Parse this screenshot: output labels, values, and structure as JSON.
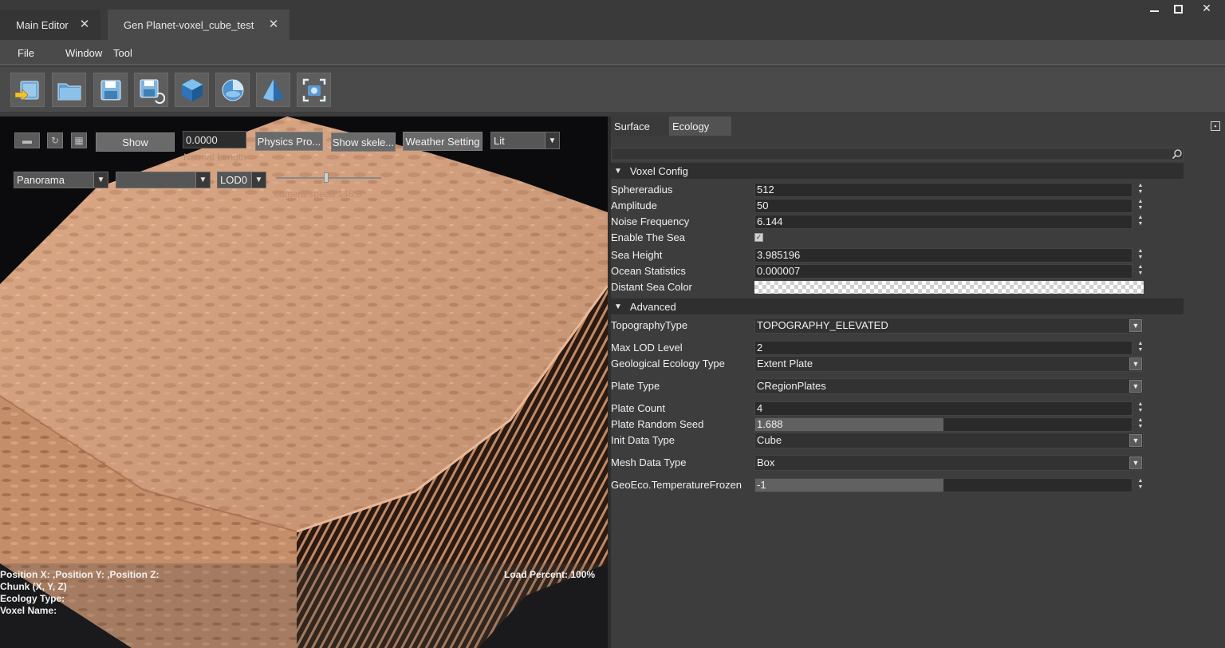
{
  "tabs": {
    "main_editor": "Main Editor",
    "gen_planet": "Gen Planet-voxel_cube_test"
  },
  "menu": {
    "file": "File",
    "window": "Window",
    "tool": "Tool"
  },
  "toolbar": {
    "icons": [
      "import-icon",
      "open-folder-icon",
      "save-icon",
      "save-as-icon",
      "cube-icon",
      "sphere-icon",
      "pyramid-icon",
      "capture-icon"
    ]
  },
  "viewport": {
    "show_label": "Show",
    "normal_length_value": "0.0000",
    "normal_length_caption": "Normal Length",
    "physics_label": "Physics Pro...",
    "skeleton_label": "Show skele...",
    "weather_label": "Weather Setting",
    "lit_value": "Lit",
    "panorama_value": "Panorama",
    "empty_select_value": "",
    "lod_value": "LOD0",
    "camera_speed_caption": "camera speed 148.3",
    "camera_speed_level": 0.48,
    "hud": {
      "position": "Position X: ,Position Y: ,Position Z:",
      "chunk": "Chunk (X, Y, Z)",
      "ecology_type": "Ecology Type:",
      "voxel_name": "Voxel Name:",
      "load_percent": "Load Percent: 100%"
    }
  },
  "panel": {
    "tab_surface": "Surface",
    "tab_ecology": "Ecology",
    "search_placeholder": "",
    "voxel_config": {
      "title": "Voxel Config",
      "sphereradius_label": "Sphereradius",
      "sphereradius_value": "512",
      "amplitude_label": "Amplitude",
      "amplitude_value": "50",
      "noise_frequency_label": "Noise Frequency",
      "noise_frequency_value": "6.144",
      "enable_sea_label": "Enable The Sea",
      "enable_sea_checked": true,
      "sea_height_label": "Sea Height",
      "sea_height_value": "3.985196",
      "ocean_statistics_label": "Ocean Statistics",
      "ocean_statistics_value": "0.000007",
      "distant_sea_color_label": "Distant Sea Color"
    },
    "advanced": {
      "title": "Advanced",
      "topography_type_label": "TopographyType",
      "topography_type_value": "TOPOGRAPHY_ELEVATED",
      "max_lod_label": "Max LOD Level",
      "max_lod_value": "2",
      "geo_ecology_type_label": "Geological Ecology Type",
      "geo_ecology_type_value": "Extent Plate",
      "plate_type_label": "Plate Type",
      "plate_type_value": "CRegionPlates",
      "plate_count_label": "Plate Count",
      "plate_count_value": "4",
      "plate_random_seed_label": "Plate Random Seed",
      "plate_random_seed_value": "1.688",
      "plate_random_seed_fill": 0.5,
      "init_data_type_label": "Init Data Type",
      "init_data_type_value": "Cube",
      "mesh_data_type_label": "Mesh Data Type",
      "mesh_data_type_value": "Box",
      "temperature_frozen_label": "GeoEco.TemperatureFrozen",
      "temperature_frozen_value": "-1",
      "temperature_frozen_fill": 0.5
    }
  },
  "colors": {
    "terrain": "#d9a27c",
    "terrain_dark": "#3a2418",
    "background": "#3c3c3c"
  }
}
